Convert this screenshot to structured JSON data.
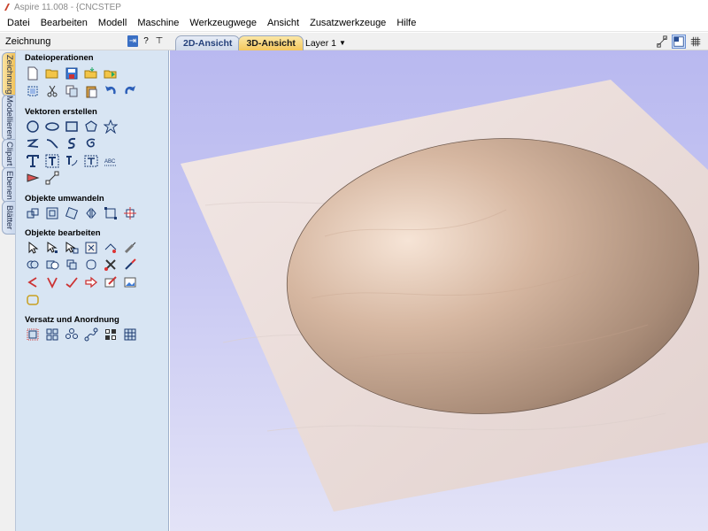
{
  "window": {
    "title": "Aspire 11.008 - {CNCSTEP"
  },
  "menu": [
    "Datei",
    "Bearbeiten",
    "Modell",
    "Maschine",
    "Werkzeugwege",
    "Ansicht",
    "Zusatzwerkzeuge",
    "Hilfe"
  ],
  "panel": {
    "title": "Zeichnung",
    "help_label": "?",
    "pin_label": "⊤"
  },
  "view_tabs": {
    "tab_2d": "2D-Ansicht",
    "tab_3d": "3D-Ansicht",
    "active": "3D-Ansicht"
  },
  "layer": {
    "label": "Layer 1"
  },
  "side_tabs": [
    "Zeichnung",
    "Modellieren",
    "Clipart",
    "Ebenen",
    "Blätter"
  ],
  "sections": {
    "file_ops": "Dateioperationen",
    "create_vectors": "Vektoren erstellen",
    "transform": "Objekte umwandeln",
    "edit": "Objekte  bearbeiten",
    "offset": "Versatz und Anordnung"
  },
  "icons": {
    "file_ops": [
      [
        "new-file-icon",
        "open-folder-icon",
        "save-icon",
        "import-folder-icon",
        "export-icon"
      ],
      [
        "select-all-icon",
        "cut-icon",
        "copy-icon",
        "paste-icon",
        "undo-icon",
        "redo-icon"
      ]
    ],
    "create_vectors": [
      [
        "circle-icon",
        "ellipse-icon",
        "rectangle-icon",
        "polygon-icon",
        "star-icon"
      ],
      [
        "polyline-icon",
        "curve-icon",
        "spline-icon",
        "spiral-icon"
      ],
      [
        "text-icon",
        "text-box-icon",
        "text-on-curve-icon",
        "text-fit-icon",
        "auto-layout-text-icon"
      ],
      [
        "dimension-icon",
        "measure-icon"
      ]
    ],
    "transform": [
      [
        "move-icon",
        "scale-icon",
        "rotate-icon",
        "mirror-icon",
        "distort-icon",
        "align-icon"
      ]
    ],
    "edit": [
      [
        "select-icon",
        "node-edit-icon",
        "interactive-select-icon",
        "trim-icon",
        "tangent-icon",
        "measure-tool-icon"
      ],
      [
        "weld-icon",
        "subtract-icon",
        "intersect-icon",
        "fillet-icon",
        "scissors-icon",
        "extend-icon"
      ],
      [
        "open-vector-icon",
        "join-icon",
        "smooth-icon",
        "arrow-icon",
        "draw-icon",
        "image-icon"
      ],
      []
    ],
    "offset": [
      [
        "offset-icon",
        "grid-array-icon",
        "circle-array-icon",
        "nest-icon",
        "block-icon",
        "pattern-icon"
      ]
    ]
  }
}
